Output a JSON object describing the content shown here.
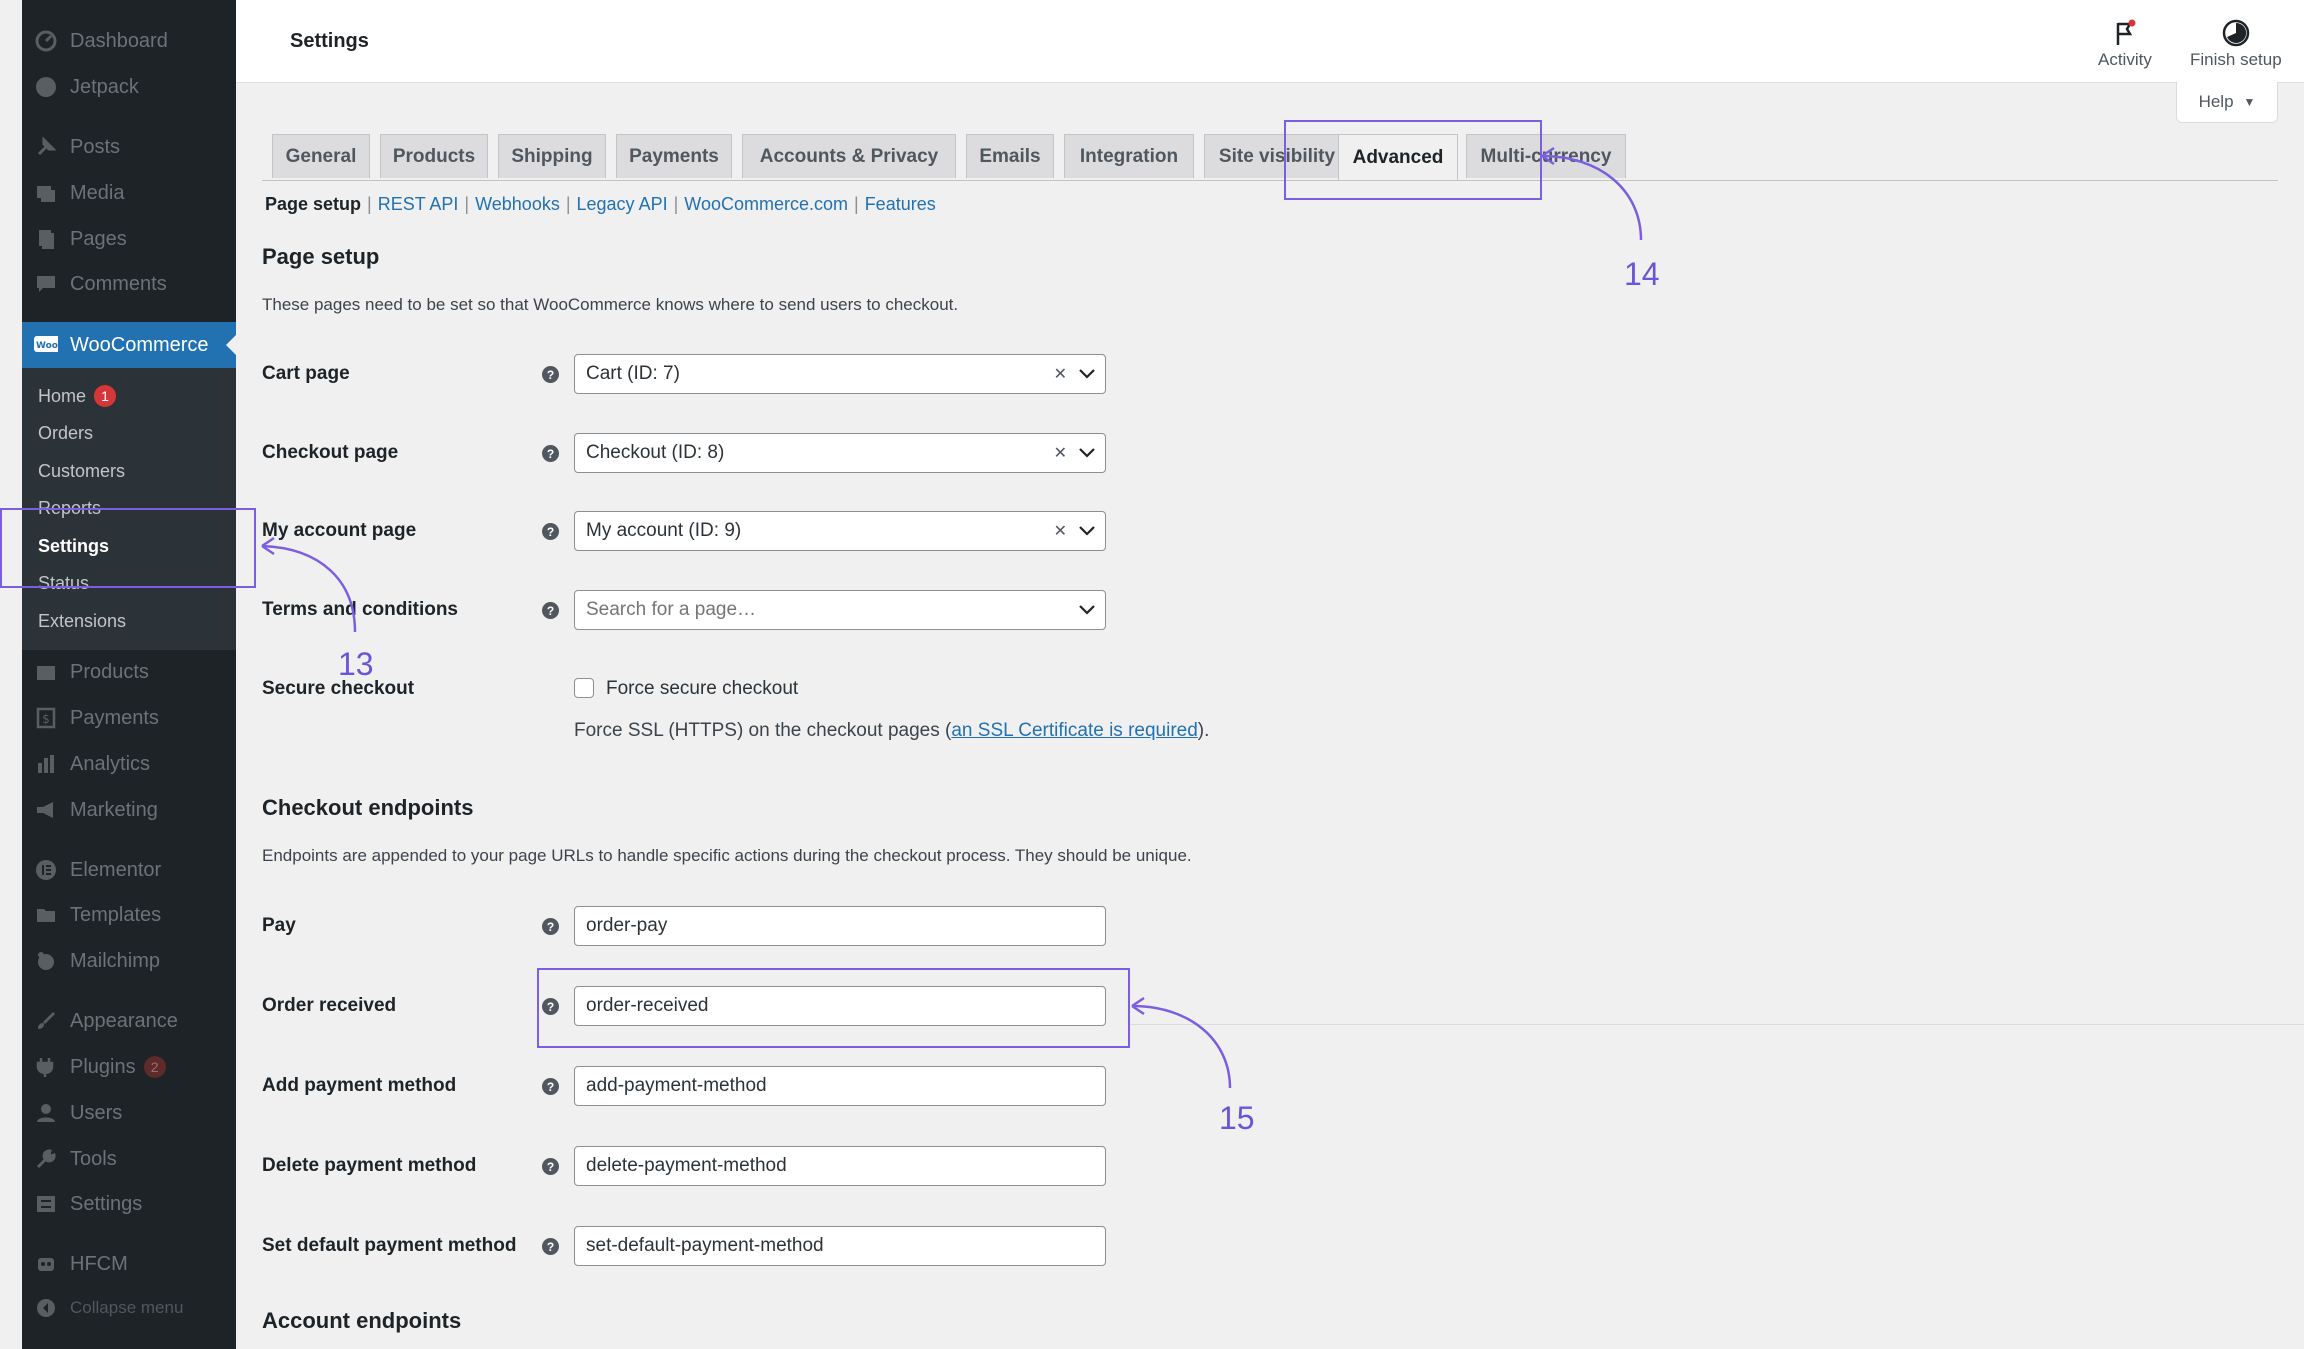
{
  "sidebar": {
    "top_items": [
      {
        "label": "Dashboard",
        "icon": "dashboard-icon"
      },
      {
        "label": "Jetpack",
        "icon": "jetpack-icon"
      },
      {
        "label": "Posts",
        "icon": "pin-icon"
      },
      {
        "label": "Media",
        "icon": "media-icon"
      },
      {
        "label": "Pages",
        "icon": "page-icon"
      },
      {
        "label": "Comments",
        "icon": "comment-icon"
      }
    ],
    "woocommerce": {
      "label": "WooCommerce",
      "icon": "woo-icon",
      "icon_text": "Woo"
    },
    "submenu": [
      {
        "label": "Home",
        "badge": "1"
      },
      {
        "label": "Orders"
      },
      {
        "label": "Customers"
      },
      {
        "label": "Reports"
      },
      {
        "label": "Settings"
      },
      {
        "label": "Status"
      },
      {
        "label": "Extensions"
      }
    ],
    "bottom_items": [
      {
        "label": "Products",
        "icon": "products-icon"
      },
      {
        "label": "Payments",
        "icon": "payments-icon"
      },
      {
        "label": "Analytics",
        "icon": "analytics-icon"
      },
      {
        "label": "Marketing",
        "icon": "megaphone-icon"
      },
      {
        "label": "Elementor",
        "icon": "elementor-icon"
      },
      {
        "label": "Templates",
        "icon": "folder-icon"
      },
      {
        "label": "Mailchimp",
        "icon": "mailchimp-icon"
      },
      {
        "label": "Appearance",
        "icon": "brush-icon"
      },
      {
        "label": "Plugins",
        "icon": "plugin-icon",
        "badge": "2"
      },
      {
        "label": "Users",
        "icon": "user-icon"
      },
      {
        "label": "Tools",
        "icon": "wrench-icon"
      },
      {
        "label": "Settings",
        "icon": "settings-icon"
      },
      {
        "label": "HFCM",
        "icon": "robot-icon"
      },
      {
        "label": "Collapse menu",
        "icon": "collapse-icon"
      }
    ]
  },
  "header": {
    "title": "Settings",
    "activity_label": "Activity",
    "finish_setup_label": "Finish setup",
    "help_label": "Help"
  },
  "tabs": [
    {
      "label": "General"
    },
    {
      "label": "Products"
    },
    {
      "label": "Shipping"
    },
    {
      "label": "Payments"
    },
    {
      "label": "Accounts & Privacy"
    },
    {
      "label": "Emails"
    },
    {
      "label": "Integration"
    },
    {
      "label": "Site visibility"
    },
    {
      "label": "Advanced",
      "active": true
    },
    {
      "label": "Multi-currency"
    }
  ],
  "subnav": [
    {
      "label": "Page setup",
      "current": true
    },
    {
      "label": "REST API"
    },
    {
      "label": "Webhooks"
    },
    {
      "label": "Legacy API"
    },
    {
      "label": "WooCommerce.com"
    },
    {
      "label": "Features"
    }
  ],
  "page_setup": {
    "heading": "Page setup",
    "description": "These pages need to be set so that WooCommerce knows where to send users to checkout.",
    "cart_label": "Cart page",
    "cart_value": "Cart (ID: 7)",
    "checkout_label": "Checkout page",
    "checkout_value": "Checkout (ID: 8)",
    "account_label": "My account page",
    "account_value": "My account (ID: 9)",
    "terms_label": "Terms and conditions",
    "terms_placeholder": "Search for a page…",
    "secure_label": "Secure checkout",
    "force_label": "Force secure checkout",
    "ssl_text_before": "Force SSL (HTTPS) on the checkout pages (",
    "ssl_link": "an SSL Certificate is required",
    "ssl_text_after": ")."
  },
  "checkout_endpoints": {
    "heading": "Checkout endpoints",
    "description": "Endpoints are appended to your page URLs to handle specific actions during the checkout process. They should be unique.",
    "pay_label": "Pay",
    "pay_value": "order-pay",
    "received_label": "Order received",
    "received_value": "order-received",
    "add_pm_label": "Add payment method",
    "add_pm_value": "add-payment-method",
    "delete_pm_label": "Delete payment method",
    "delete_pm_value": "delete-payment-method",
    "default_pm_label": "Set default payment method",
    "default_pm_value": "set-default-payment-method"
  },
  "account_endpoints": {
    "heading": "Account endpoints"
  },
  "annotations": {
    "n13": "13",
    "n14": "14",
    "n15": "15"
  },
  "colors": {
    "accent": "#2271b1",
    "annotation": "#7b5fe0",
    "sidebar": "#1d2327"
  }
}
